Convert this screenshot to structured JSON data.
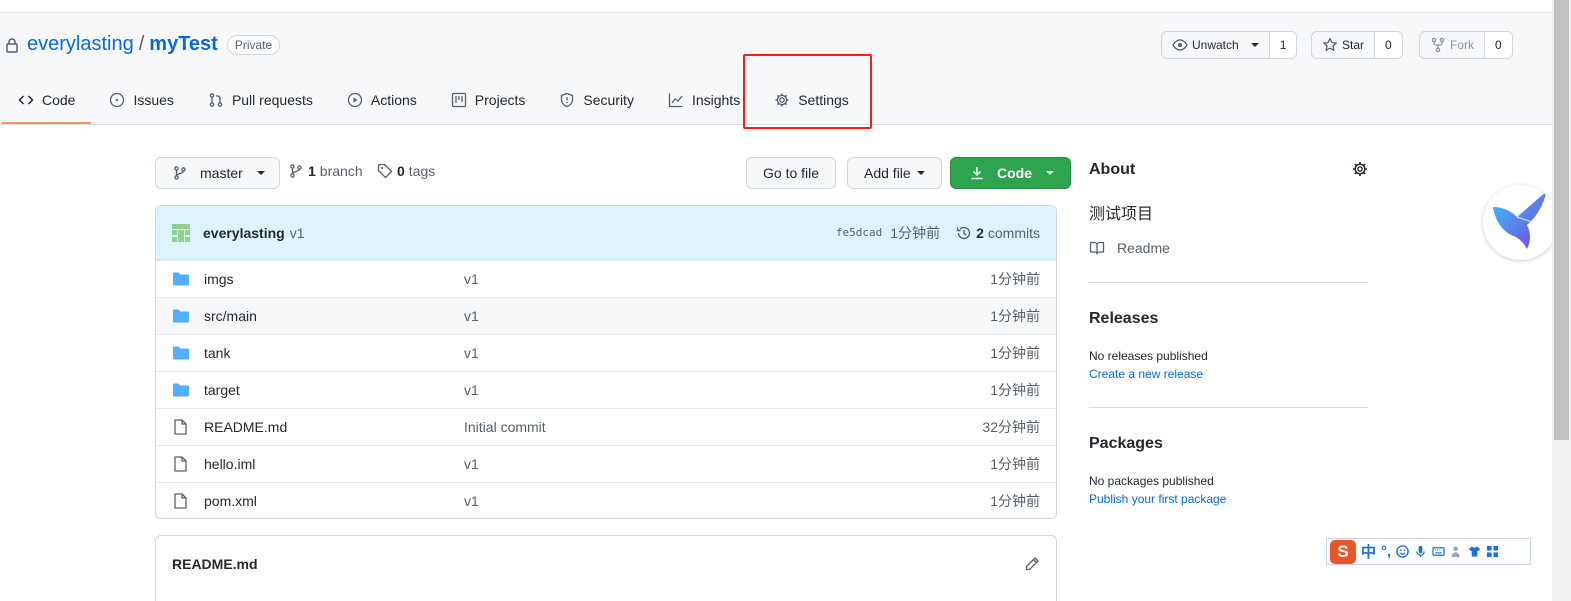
{
  "repo": {
    "owner": "everylasting",
    "separator": "/",
    "name": "myTest",
    "visibility": "Private"
  },
  "actions": {
    "watch_label": "Unwatch",
    "watch_count": "1",
    "star_label": "Star",
    "star_count": "0",
    "fork_label": "Fork",
    "fork_count": "0"
  },
  "tabs": [
    {
      "label": "Code",
      "icon": "code-icon"
    },
    {
      "label": "Issues",
      "icon": "issue-icon"
    },
    {
      "label": "Pull requests",
      "icon": "pull-request-icon"
    },
    {
      "label": "Actions",
      "icon": "play-icon"
    },
    {
      "label": "Projects",
      "icon": "project-icon"
    },
    {
      "label": "Security",
      "icon": "shield-icon"
    },
    {
      "label": "Insights",
      "icon": "graph-icon"
    },
    {
      "label": "Settings",
      "icon": "gear-icon"
    }
  ],
  "toolbar": {
    "branch_name": "master",
    "branch_count": "1",
    "branch_word": "branch",
    "tag_count": "0",
    "tag_word": "tags",
    "go_to_file": "Go to file",
    "add_file": "Add file",
    "code": "Code"
  },
  "commit": {
    "author": "everylasting",
    "message": "v1",
    "sha": "fe5dcad",
    "time": "1分钟前",
    "commit_count": "2",
    "commit_word": "commits"
  },
  "files": [
    {
      "type": "folder",
      "name": "imgs",
      "message": "v1",
      "age": "1分钟前"
    },
    {
      "type": "folder",
      "name": "src/main",
      "message": "v1",
      "age": "1分钟前"
    },
    {
      "type": "folder",
      "name": "tank",
      "message": "v1",
      "age": "1分钟前"
    },
    {
      "type": "folder",
      "name": "target",
      "message": "v1",
      "age": "1分钟前"
    },
    {
      "type": "file",
      "name": "README.md",
      "message": "Initial commit",
      "age": "32分钟前"
    },
    {
      "type": "file",
      "name": "hello.iml",
      "message": "v1",
      "age": "1分钟前"
    },
    {
      "type": "file",
      "name": "pom.xml",
      "message": "v1",
      "age": "1分钟前"
    }
  ],
  "readme": {
    "title": "README.md"
  },
  "sidebar": {
    "about_heading": "About",
    "description": "测试项目",
    "readme_link": "Readme",
    "releases_heading": "Releases",
    "releases_text": "No releases published",
    "releases_link": "Create a new release",
    "packages_heading": "Packages",
    "packages_text": "No packages published",
    "packages_link": "Publish your first package"
  },
  "ime": {
    "logo": "S",
    "mode": "中",
    "punct": "°,"
  },
  "colors": {
    "accent": "#0969da",
    "green": "#2da44e",
    "highlight": "#ff1a1a",
    "tab_underline": "#fd8c73"
  }
}
